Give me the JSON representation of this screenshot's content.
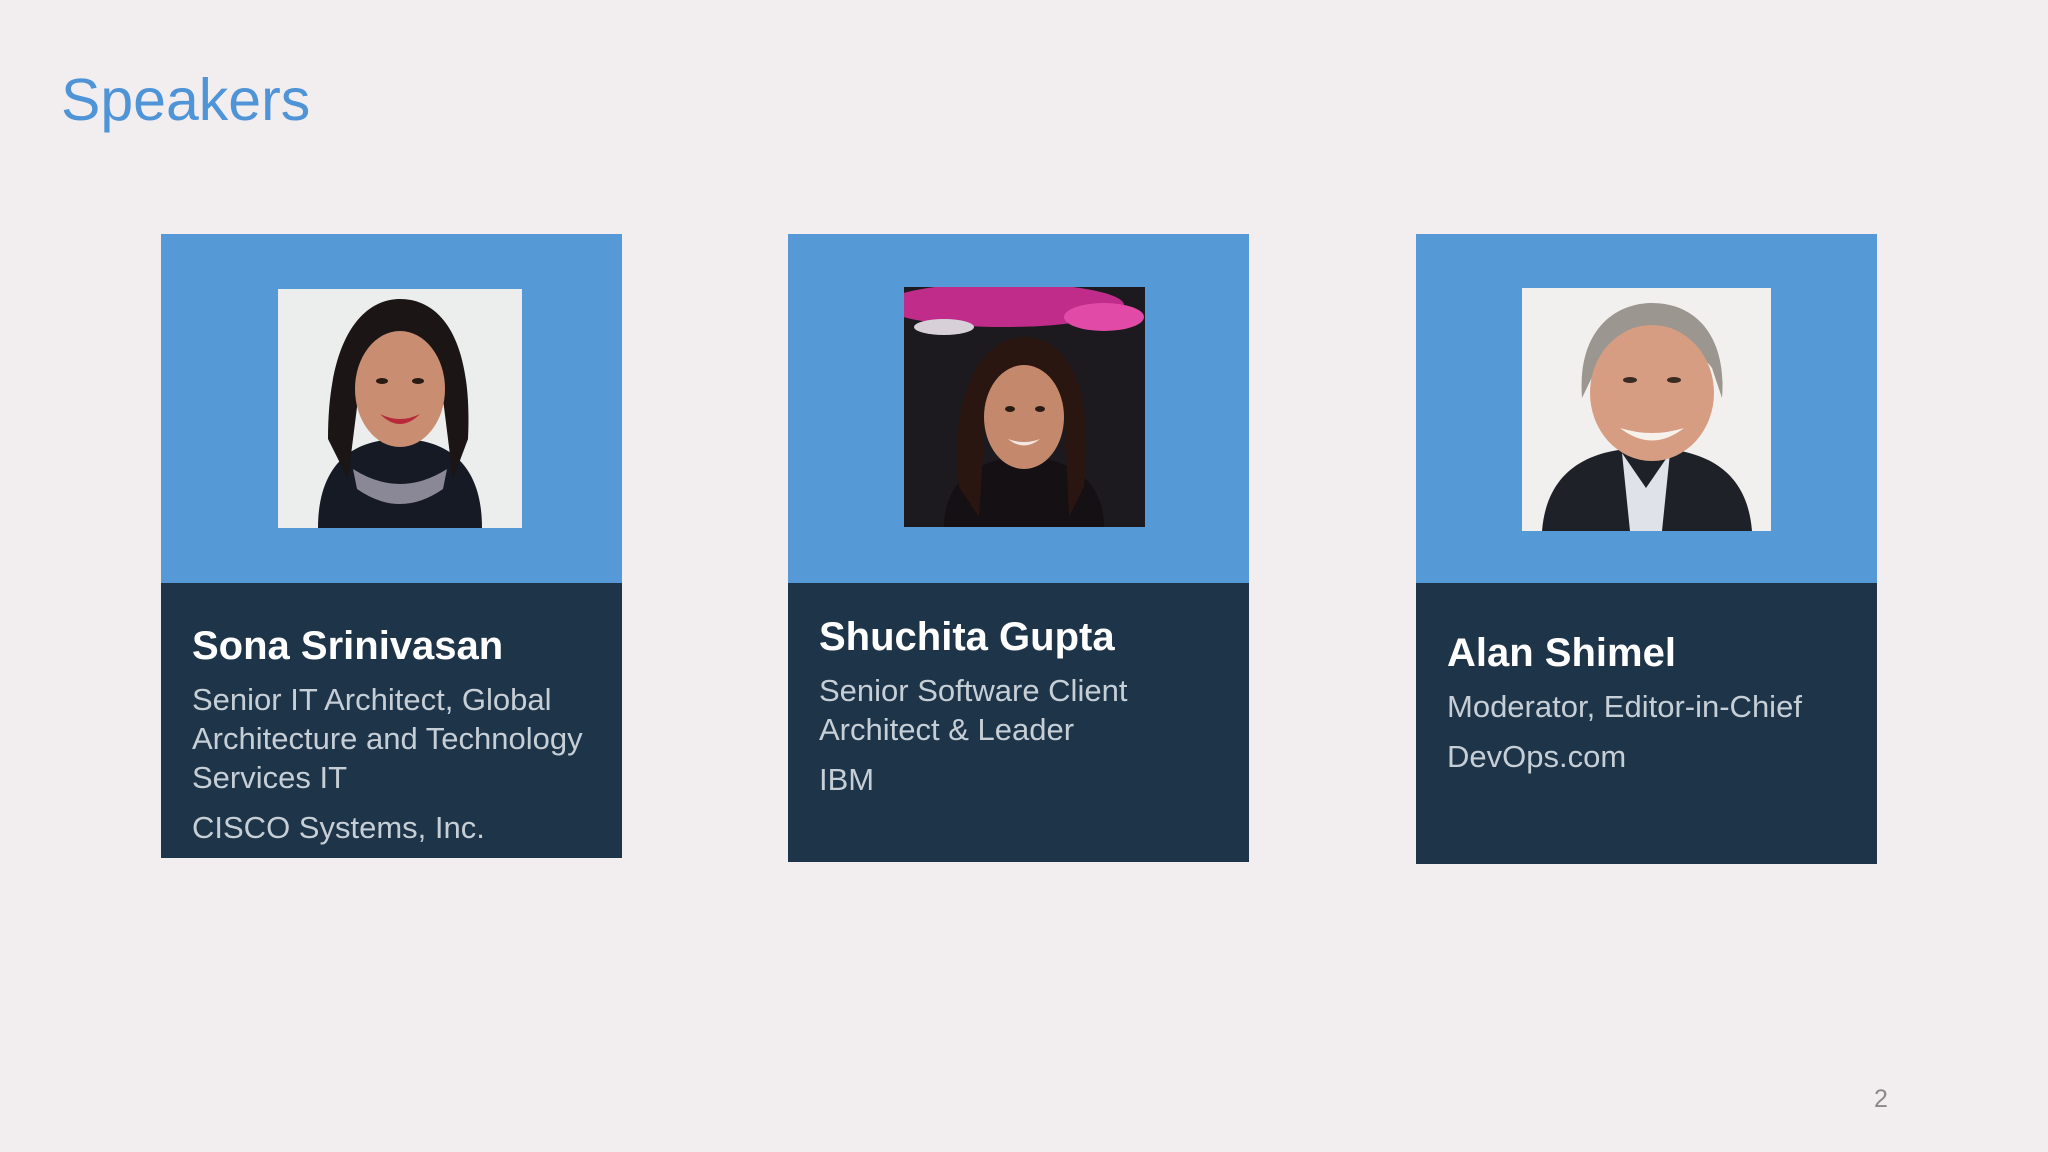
{
  "slide": {
    "title": "Speakers",
    "page_number": "2",
    "colors": {
      "background": "#f2eef0",
      "title": "#4f94d6",
      "card_top": "#5599d7",
      "card_bottom": "#1e3449"
    }
  },
  "speakers": [
    {
      "name": "Sona Srinivasan",
      "role": "Senior IT Architect, Global Architecture and Technology Services IT",
      "organization": "CISCO Systems, Inc."
    },
    {
      "name": "Shuchita Gupta",
      "role": "Senior Software Client Architect & Leader",
      "organization": "IBM"
    },
    {
      "name": "Alan Shimel",
      "role": "Moderator, Editor-in-Chief",
      "organization": "DevOps.com"
    }
  ]
}
